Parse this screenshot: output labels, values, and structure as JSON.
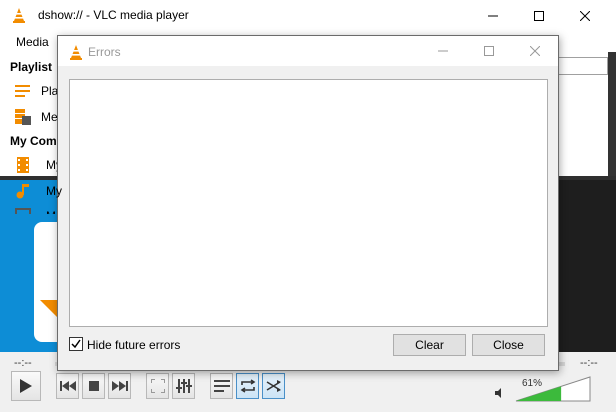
{
  "app": {
    "title": "dshow:// - VLC media player",
    "menu_items": [
      "Media"
    ]
  },
  "sidebar": {
    "playlist_header": "Playlist",
    "items_playlist": [
      {
        "label": "Play",
        "icon": "playlist-icon"
      },
      {
        "label": "Me",
        "icon": "media-library-icon"
      }
    ],
    "computer_header": "My Comp",
    "items_computer": [
      {
        "label": "My",
        "icon": "film-icon"
      },
      {
        "label": "My",
        "icon": "music-icon"
      },
      {
        "label": "M",
        "icon": "picture-icon"
      }
    ]
  },
  "player": {
    "time_elapsed": "--:--",
    "time_total": "--:--",
    "volume_percent": "61%",
    "volume_level": 0.61,
    "loop_active": true,
    "random_active": true
  },
  "errors_dialog": {
    "title": "Errors",
    "hide_future_label": "Hide future errors",
    "hide_future_checked": true,
    "clear_label": "Clear",
    "close_label": "Close"
  },
  "colors": {
    "vlc_orange": "#f28c00",
    "background_blue": "#0d8dd6",
    "volume_green": "#3cba3c"
  }
}
